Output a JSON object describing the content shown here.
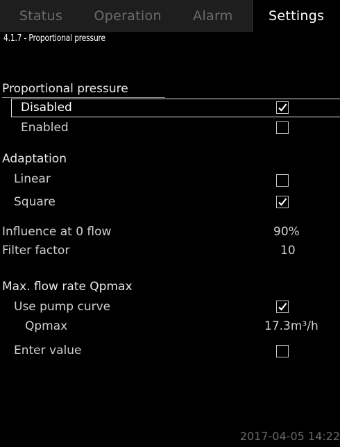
{
  "tabs": {
    "status": "Status",
    "operation": "Operation",
    "alarm": "Alarm",
    "settings": "Settings"
  },
  "breadcrumb": "4.1.7 - Proportional pressure",
  "proportional_pressure": {
    "heading": "Proportional pressure",
    "disabled_label": "Disabled",
    "disabled_checked": true,
    "enabled_label": "Enabled",
    "enabled_checked": false
  },
  "adaptation": {
    "heading": "Adaptation",
    "linear_label": "Linear",
    "linear_checked": false,
    "square_label": "Square",
    "square_checked": true
  },
  "influence": {
    "label": "Influence at 0 flow",
    "value": "90%"
  },
  "filter": {
    "label": "Filter factor",
    "value": "10"
  },
  "max_flow": {
    "heading": "Max. flow rate Qpmax",
    "use_pump_curve_label": "Use pump curve",
    "use_pump_curve_checked": true,
    "qpmax_label": "Qpmax",
    "qpmax_value": "17.3m³/h",
    "enter_value_label": "Enter value",
    "enter_value_checked": false
  },
  "footer": {
    "datetime": "2017-04-05 14:22"
  },
  "icons": {
    "checkbox_checked": "checkmark-icon",
    "checkbox_unchecked": "empty-checkbox-icon"
  }
}
